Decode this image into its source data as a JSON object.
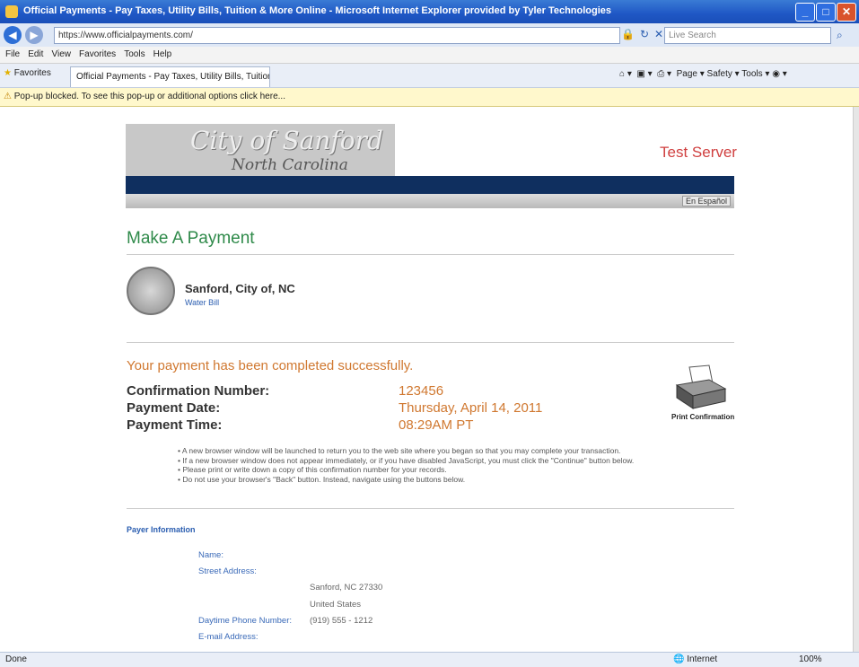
{
  "window": {
    "title": "Official Payments - Pay Taxes, Utility Bills, Tuition & More Online - Microsoft Internet Explorer provided by Tyler Technologies",
    "min": "_",
    "max": "□",
    "close": "✕"
  },
  "address_bar": {
    "url": "https://www.officialpayments.com/",
    "search_placeholder": "Live Search"
  },
  "menu": [
    "File",
    "Edit",
    "View",
    "Favorites",
    "Tools",
    "Help"
  ],
  "favorites_label": "Favorites",
  "tab_label": "Official Payments - Pay Taxes, Utility Bills, Tuition & M...",
  "command_bar": "Page ▾   Safety ▾   Tools ▾",
  "info_bar": "Pop-up blocked. To see this pop-up or additional options click here...",
  "header": {
    "logo_line1": "City of Sanford",
    "logo_line2": "North Carolina",
    "test_server": "Test Server",
    "english_button": "En Español"
  },
  "page_title": "Make A Payment",
  "org": {
    "name": "Sanford, City of, NC",
    "sub": "Water Bill"
  },
  "success_message": "Your payment has been completed successfully.",
  "confirmation": {
    "conf_label": "Confirmation Number:",
    "conf_value": "123456",
    "date_label": "Payment Date:",
    "date_value": "Thursday, April 14, 2011",
    "time_label": "Payment Time:",
    "time_value": "08:29AM PT"
  },
  "print_label": "Print Confirmation",
  "notes": [
    "• A new browser window will be launched to return you to the web site where you began so that you may complete your transaction.",
    "• If a new browser window does not appear immediately, or if you have disabled JavaScript, you must click the \"Continue\" button below.",
    "• Please print or write down a copy of this confirmation number for your records.",
    "• Do not use your browser's \"Back\" button. Instead, navigate using the buttons below."
  ],
  "payer": {
    "heading": "Payer Information",
    "name_label": "Name:",
    "street_label": "Street Address:",
    "city_value": "Sanford, NC 27330",
    "country_value": "United States",
    "phone_label": "Daytime Phone Number:",
    "phone_value": "(919) 555 - 1212",
    "email_label": "E-mail Address:"
  },
  "status_bar": {
    "left": "Done",
    "zone": "Internet",
    "zoom": "100%"
  }
}
